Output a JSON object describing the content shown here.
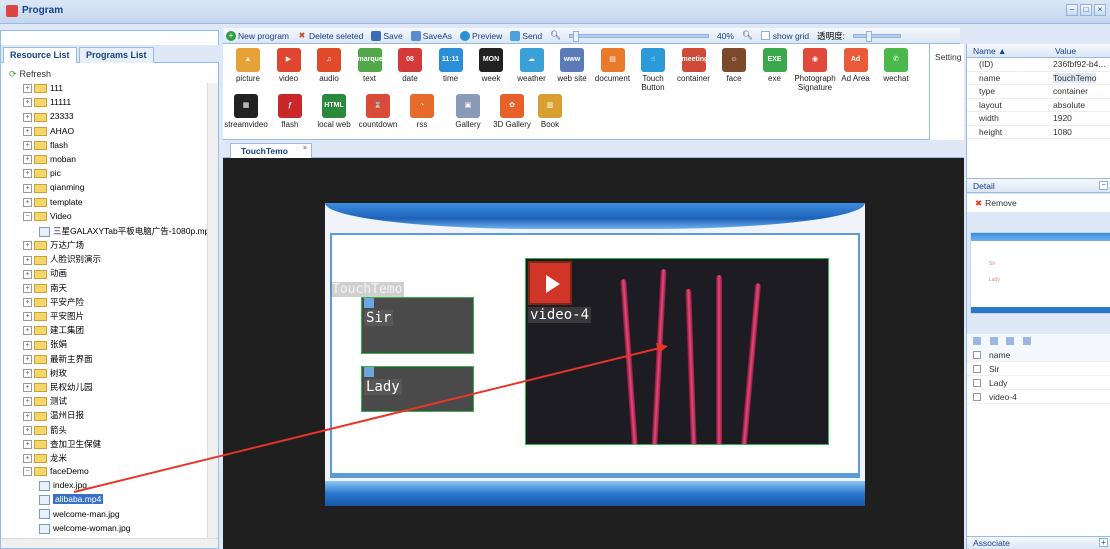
{
  "window": {
    "title": "Program",
    "min": "–",
    "max": "□",
    "close": "×"
  },
  "left": {
    "collapse": "«",
    "tabs": [
      "Resource List",
      "Programs List"
    ],
    "refresh": "Refresh",
    "tree": [
      {
        "label": "111",
        "type": "folder",
        "exp": "+"
      },
      {
        "label": "11111",
        "type": "folder",
        "exp": "+"
      },
      {
        "label": "23333",
        "type": "folder",
        "exp": "+"
      },
      {
        "label": "AHAO",
        "type": "folder",
        "exp": "+"
      },
      {
        "label": "flash",
        "type": "folder",
        "exp": "+"
      },
      {
        "label": "moban",
        "type": "folder",
        "exp": "+"
      },
      {
        "label": "pic",
        "type": "folder",
        "exp": "+"
      },
      {
        "label": "qianming",
        "type": "folder",
        "exp": "+"
      },
      {
        "label": "template",
        "type": "folder",
        "exp": "+"
      },
      {
        "label": "Video",
        "type": "folder",
        "exp": "−"
      },
      {
        "label": "三星GALAXYTab平板电脑广告-1080p.mp4",
        "type": "file",
        "indent": 1
      },
      {
        "label": "万达广场",
        "type": "folder",
        "exp": "+"
      },
      {
        "label": "人脸识别演示",
        "type": "folder",
        "exp": "+"
      },
      {
        "label": "动画",
        "type": "folder",
        "exp": "+"
      },
      {
        "label": "南天",
        "type": "folder",
        "exp": "+"
      },
      {
        "label": "平安产险",
        "type": "folder",
        "exp": "+"
      },
      {
        "label": "平安图片",
        "type": "folder",
        "exp": "+"
      },
      {
        "label": "建工集团",
        "type": "folder",
        "exp": "+"
      },
      {
        "label": "张娟",
        "type": "folder",
        "exp": "+"
      },
      {
        "label": "最新主界面",
        "type": "folder",
        "exp": "+"
      },
      {
        "label": "树玫",
        "type": "folder",
        "exp": "+"
      },
      {
        "label": "民权幼儿园",
        "type": "folder",
        "exp": "+"
      },
      {
        "label": "测试",
        "type": "folder",
        "exp": "+"
      },
      {
        "label": "温州日报",
        "type": "folder",
        "exp": "+"
      },
      {
        "label": "箭头",
        "type": "folder",
        "exp": "+"
      },
      {
        "label": "查加卫生保健",
        "type": "folder",
        "exp": "+"
      },
      {
        "label": "龙米",
        "type": "folder",
        "exp": "+"
      },
      {
        "label": "faceDemo",
        "type": "folder",
        "exp": "−"
      },
      {
        "label": "index.jpg",
        "type": "file",
        "indent": 1
      },
      {
        "label": "alibaba.mp4",
        "type": "file",
        "indent": 1,
        "selected": true
      },
      {
        "label": "welcome-man.jpg",
        "type": "file",
        "indent": 1
      },
      {
        "label": "welcome-woman.jpg",
        "type": "file",
        "indent": 1
      }
    ]
  },
  "toolbar": {
    "new_program": "New program",
    "delete_selected": "Delete seleted",
    "save": "Save",
    "save_as": "SaveAs",
    "preview": "Preview",
    "send": "Send",
    "zoom": "40%",
    "show_grid": "show grid",
    "opacity_label": "透明度:"
  },
  "palette": [
    {
      "label": "picture",
      "color": "#e8a23a",
      "glyph": "▲"
    },
    {
      "label": "video",
      "color": "#e0462f",
      "glyph": "▶"
    },
    {
      "label": "audio",
      "color": "#e04a2a",
      "glyph": "♫"
    },
    {
      "label": "text",
      "color": "#52a84a",
      "glyph": "marquee"
    },
    {
      "label": "date",
      "color": "#d43a3a",
      "glyph": "08"
    },
    {
      "label": "time",
      "color": "#2a8ed8",
      "glyph": "11:11"
    },
    {
      "label": "week",
      "color": "#222222",
      "glyph": "MON"
    },
    {
      "label": "weather",
      "color": "#3aa0d8",
      "glyph": "☁"
    },
    {
      "label": "web site",
      "color": "#5a7ab8",
      "glyph": "www"
    },
    {
      "label": "document",
      "color": "#e87a2a",
      "glyph": "▤"
    },
    {
      "label": "Touch Button",
      "color": "#2a9ad8",
      "glyph": "☝"
    },
    {
      "label": "container",
      "color": "#d04a3a",
      "glyph": "meeting"
    },
    {
      "label": "face",
      "color": "#7a4a2a",
      "glyph": "☺"
    },
    {
      "label": "exe",
      "color": "#3aa84a",
      "glyph": "EXE"
    },
    {
      "label": "Photograph Signature",
      "color": "#e04a3a",
      "glyph": "◉"
    },
    {
      "label": "Ad Area",
      "color": "#e85a3a",
      "glyph": "Ad"
    },
    {
      "label": "wechat",
      "color": "#4ab84a",
      "glyph": "✆"
    },
    {
      "label": "streamvideo",
      "color": "#222222",
      "glyph": "▦"
    },
    {
      "label": "flash",
      "color": "#c8282a",
      "glyph": "ƒ"
    },
    {
      "label": "local web",
      "color": "#2a8a3a",
      "glyph": "HTML"
    },
    {
      "label": "countdown",
      "color": "#d84a3a",
      "glyph": "⌛"
    },
    {
      "label": "rss",
      "color": "#e86a2a",
      "glyph": "◔"
    },
    {
      "label": "Gallery",
      "color": "#8a9ab8",
      "glyph": "▣"
    },
    {
      "label": "3D Gallery",
      "color": "#e8602a",
      "glyph": "✿"
    },
    {
      "label": "Book",
      "color": "#d8a030",
      "glyph": "▥"
    }
  ],
  "setting": "Setting",
  "editor": {
    "tab": "TouchTemo",
    "tab_close": "×",
    "container_label": "TouchTemo",
    "buttons": [
      "Sir",
      "Lady"
    ],
    "video_label": "video-4"
  },
  "properties": {
    "col_name": "Name ▲",
    "col_value": "Value",
    "rows": [
      {
        "name": "(ID)",
        "value": "236fbf92-b4..."
      },
      {
        "name": "name",
        "value": "TouchTemo",
        "selected": true
      },
      {
        "name": "type",
        "value": "container"
      },
      {
        "name": "layout",
        "value": "absolute"
      },
      {
        "name": "width",
        "value": "1920"
      },
      {
        "name": "height",
        "value": "1080"
      }
    ]
  },
  "detail": {
    "title": "Detail",
    "collapse": "−",
    "remove": "Remove",
    "preview_text_1": "Sir",
    "preview_text_2": "Lady"
  },
  "layers": {
    "header": "name",
    "items": [
      "Sir",
      "Lady",
      "video-4"
    ]
  },
  "associate": {
    "title": "Associate",
    "add": "+"
  }
}
